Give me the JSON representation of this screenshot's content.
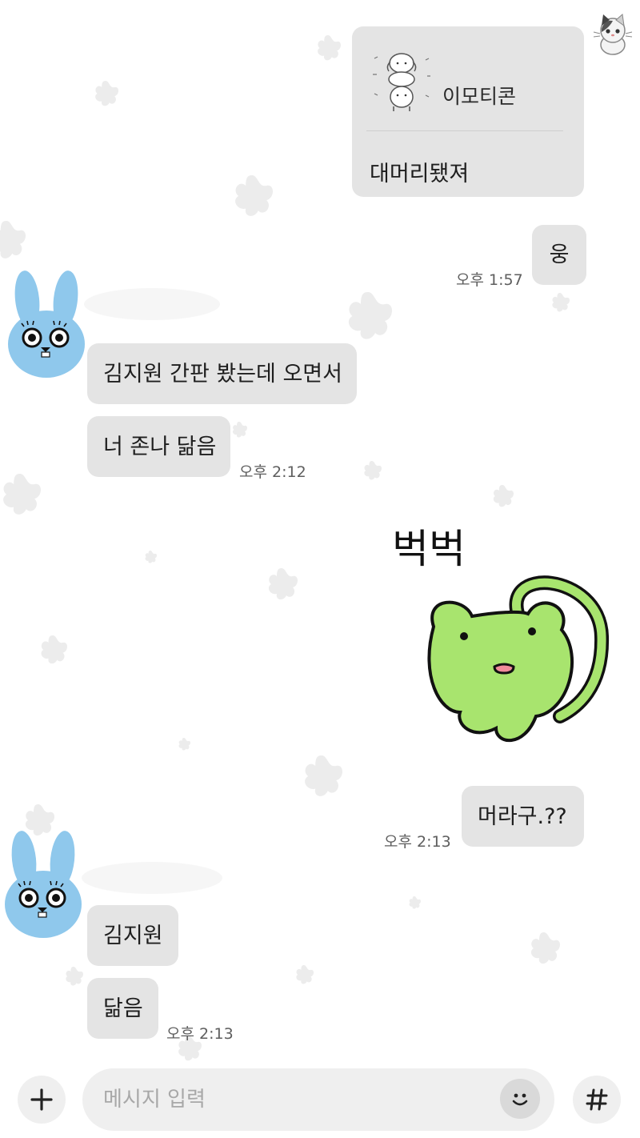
{
  "messages": [
    {
      "emoticon_label": "이모티콘",
      "text": "대머리됐져"
    },
    {
      "text": "웅",
      "time": "오후 1:57"
    },
    {
      "text": "김지원 간판 봤는데 오면서"
    },
    {
      "text": "너 존나 닮음",
      "time": "오후 2:12"
    },
    {
      "sticker_text": "벅벅"
    },
    {
      "text": "머라구.??",
      "time": "오후 2:13"
    },
    {
      "text": "김지원"
    },
    {
      "text": "닮음",
      "time": "오후 2:13"
    }
  ],
  "input": {
    "placeholder": "메시지 입력"
  },
  "icons": {
    "profile_self": "cat-icon",
    "profile_friend": "blue-rabbit-icon",
    "sticker": "green-frog-sticker",
    "plus": "plus-icon",
    "emoji": "smiley-icon",
    "hashtag": "hashtag-icon"
  },
  "colors": {
    "bubble": "#e4e4e4",
    "frog": "#a8e46e",
    "rabbit": "#8fc8ec"
  }
}
